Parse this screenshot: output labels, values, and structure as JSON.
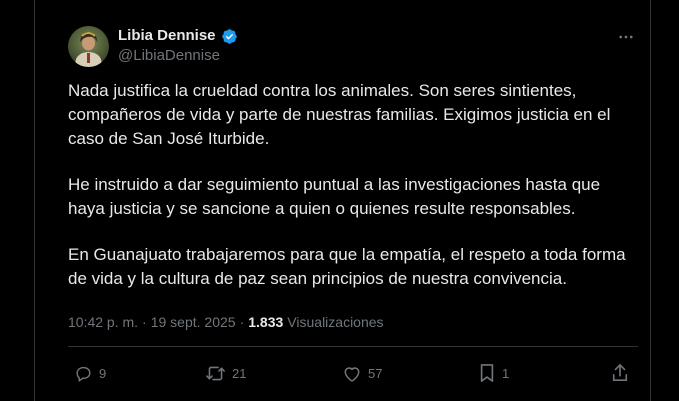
{
  "tweet": {
    "author": {
      "display_name": "Libia Dennise",
      "handle": "@LibiaDennise",
      "verified": true,
      "verified_color": "#1d9bf0"
    },
    "paragraphs": [
      "Nada justifica la crueldad contra los animales. Son seres sintientes, compañeros de vida y parte de nuestras familias. Exigimos justicia en el caso de San José Iturbide.",
      "He instruido a dar seguimiento puntual a las investigaciones hasta que haya justicia y se sancione a quien o quienes resulte responsables.",
      "En Guanajuato trabajaremos para que la empatía, el respeto a toda forma de vida y la cultura de paz sean principios de nuestra convivencia."
    ],
    "time": "10:42 p. m.",
    "separator": "·",
    "date": "19 sept. 2025",
    "views_count": "1.833",
    "views_label": "Visualizaciones"
  },
  "actions": {
    "replies": "9",
    "reposts": "21",
    "likes": "57",
    "bookmarks": "1"
  },
  "icons": {
    "more": "more-horizontal-icon",
    "reply": "reply-icon",
    "repost": "repost-icon",
    "like": "heart-icon",
    "bookmark": "bookmark-icon",
    "share": "share-icon",
    "verified": "verified-badge-icon"
  },
  "colors": {
    "background": "#000000",
    "text_primary": "#e7e9ea",
    "text_secondary": "#71767b",
    "border": "#2f3336",
    "verified": "#1d9bf0"
  }
}
